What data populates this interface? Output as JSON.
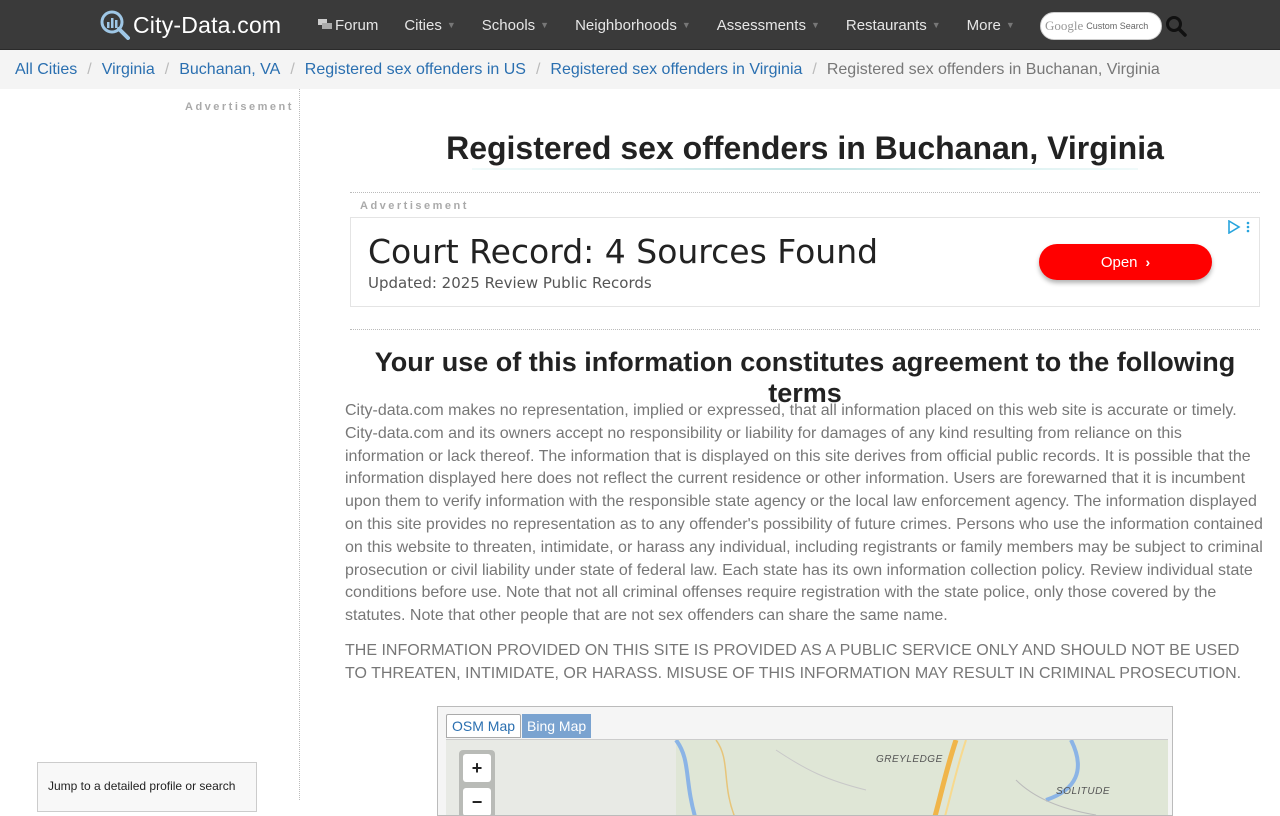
{
  "brand": {
    "name": "City-Data.com"
  },
  "nav": {
    "items": [
      {
        "label": "Forum",
        "icon": "forum-icon",
        "dropdown": false
      },
      {
        "label": "Cities",
        "dropdown": true
      },
      {
        "label": "Schools",
        "dropdown": true
      },
      {
        "label": "Neighborhoods",
        "dropdown": true
      },
      {
        "label": "Assessments",
        "dropdown": true
      },
      {
        "label": "Restaurants",
        "dropdown": true
      },
      {
        "label": "More",
        "dropdown": true
      }
    ],
    "search": {
      "google": "Google",
      "custom": "Custom Search",
      "icon": "search-icon"
    }
  },
  "breadcrumb": [
    {
      "label": "All Cities"
    },
    {
      "label": "Virginia"
    },
    {
      "label": "Buchanan, VA"
    },
    {
      "label": "Registered sex offenders in US"
    },
    {
      "label": "Registered sex offenders in Virginia"
    }
  ],
  "breadcrumb_current": "Registered sex offenders in Buchanan, Virginia",
  "sidebar": {
    "ad_label": "Advertisement",
    "jump_box": "Jump to a detailed profile or search"
  },
  "main": {
    "title": "Registered sex offenders in Buchanan, Virginia",
    "ad": {
      "label": "Advertisement",
      "headline": "Court Record: 4 Sources Found",
      "sub": "Updated: 2025 Review Public Records",
      "button": "Open"
    },
    "terms_title": "Your use of this information constitutes agreement to the following terms",
    "terms_body": "City-data.com makes no representation, implied or expressed, that all information placed on this web site is accurate or timely. City-data.com and its owners accept no responsibility or liability for damages of any kind resulting from reliance on this information or lack thereof. The information that is displayed on this site derives from official public records. It is possible that the information displayed here does not reflect the current residence or other information. Users are forewarned that it is incumbent upon them to verify information with the responsible state agency or the local law enforcement agency. The information displayed on this site provides no representation as to any offender's possibility of future crimes. Persons who use the information contained on this website to threaten, intimidate, or harass any individual, including registrants or family members may be subject to criminal prosecution or civil liability under state of federal law. Each state has its own information collection policy. Review individual state conditions before use. Note that not all criminal offenses require registration with the state police, only those covered by the statutes. Note that other people that are not sex offenders can share the same name.",
    "terms_caps": "THE INFORMATION PROVIDED ON THIS SITE IS PROVIDED AS A PUBLIC SERVICE ONLY AND SHOULD NOT BE USED TO THREATEN, INTIMIDATE, OR HARASS. MISUSE OF THIS INFORMATION MAY RESULT IN CRIMINAL PROSECUTION."
  },
  "map": {
    "tabs": [
      {
        "label": "OSM Map",
        "active": true
      },
      {
        "label": "Bing Map",
        "active": false
      }
    ],
    "zoom_in": "+",
    "zoom_out": "−",
    "labels": [
      "GREYLEDGE",
      "SOLITUDE"
    ]
  },
  "colors": {
    "topbar": "#3a3a3a",
    "link": "#2a6fb0",
    "ad_button": "#ff0000",
    "bing_tab": "#7aa3d0"
  }
}
